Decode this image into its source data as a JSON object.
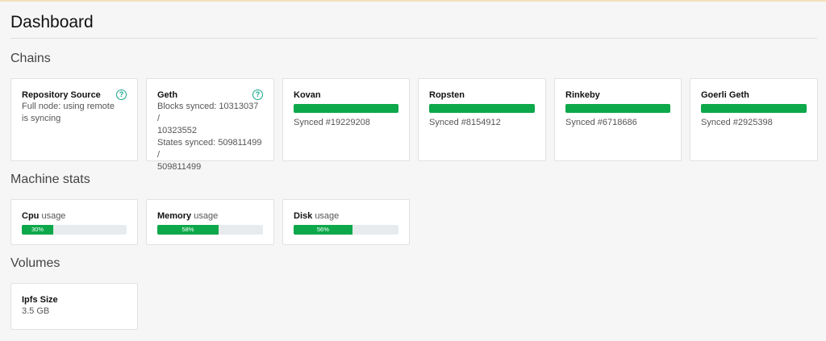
{
  "page": {
    "title": "Dashboard"
  },
  "sections": {
    "chains": "Chains",
    "machine": "Machine stats",
    "volumes": "Volumes"
  },
  "chains": [
    {
      "name": "Repository Source",
      "lines": [
        "Full node: using remote",
        "is syncing"
      ],
      "help_icon": "help-circle-icon"
    },
    {
      "name": "Geth",
      "lines": [
        "Blocks synced: 10313037 /",
        "10323552",
        "States synced: 509811499 /",
        "509811499"
      ],
      "help_icon": "help-circle-icon"
    },
    {
      "name": "Kovan",
      "progress": 1.0,
      "status": "Synced #19229208"
    },
    {
      "name": "Ropsten",
      "progress": 1.0,
      "status": "Synced #8154912"
    },
    {
      "name": "Rinkeby",
      "progress": 1.0,
      "status": "Synced #6718686"
    },
    {
      "name": "Goerli Geth",
      "progress": 1.0,
      "status": "Synced #2925398"
    }
  ],
  "machine_stats": [
    {
      "name": "Cpu",
      "suffix": "usage",
      "percent": 30,
      "percent_label": "30%"
    },
    {
      "name": "Memory",
      "suffix": "usage",
      "percent": 58,
      "percent_label": "58%"
    },
    {
      "name": "Disk",
      "suffix": "usage",
      "percent": 56,
      "percent_label": "56%"
    }
  ],
  "volumes": [
    {
      "name": "Ipfs Size",
      "value": "3.5 GB"
    }
  ],
  "colors": {
    "success": "#0da84a",
    "help": "#17a58a",
    "accent_line": "#f3e2bd"
  }
}
